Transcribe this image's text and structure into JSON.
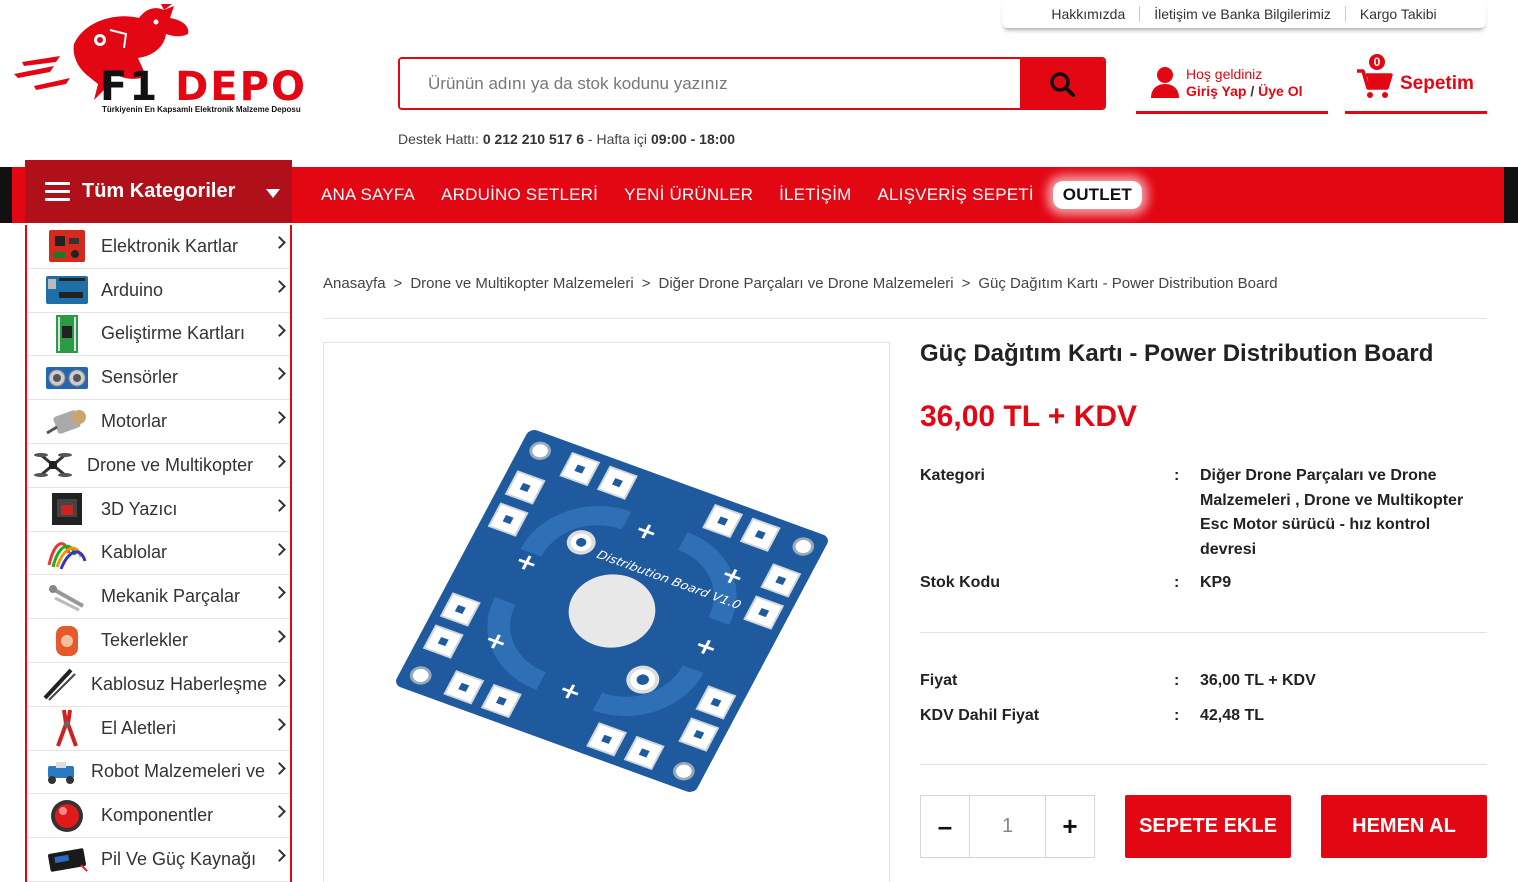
{
  "top_links": [
    "Hakkımızda",
    "İletişim ve Banka Bilgilerimiz",
    "Kargo Takibi"
  ],
  "logo": {
    "f1": "F1",
    "depo": "DEPO",
    "tagline": "Türkiyenin En Kapsamlı Elektronik Malzeme Deposu"
  },
  "search": {
    "placeholder": "Ürünün adını ya da stok kodunu yazınız"
  },
  "support": {
    "label": "Destek Hattı:",
    "phone": "0 212 210 517 6",
    "hours_label": "- Hafta içi",
    "hours": "09:00 - 18:00"
  },
  "account": {
    "greeting": "Hoş geldiniz",
    "login": "Giriş Yap",
    "slash": "/",
    "register": "Üye Ol"
  },
  "cart": {
    "count": "0",
    "label": "Sepetim"
  },
  "nav": {
    "all_categories": "Tüm Kategoriler",
    "items": [
      "ANA SAYFA",
      "ARDUİNO SETLERİ",
      "YENİ ÜRÜNLER",
      "İLETİŞİM",
      "ALIŞVERİŞ SEPETİ"
    ],
    "outlet": "OUTLET"
  },
  "categories": [
    {
      "name": "Elektronik Kartlar",
      "icon": "board-icon"
    },
    {
      "name": "Arduino",
      "icon": "arduino-icon"
    },
    {
      "name": "Geliştirme Kartları",
      "icon": "dev-board-icon"
    },
    {
      "name": "Sensörler",
      "icon": "sensor-icon"
    },
    {
      "name": "Motorlar",
      "icon": "motor-icon"
    },
    {
      "name": "Drone ve Multikopter",
      "icon": "drone-icon"
    },
    {
      "name": "3D Yazıcı",
      "icon": "printer-icon"
    },
    {
      "name": "Kablolar",
      "icon": "cable-icon"
    },
    {
      "name": "Mekanik Parçalar",
      "icon": "screw-icon"
    },
    {
      "name": "Tekerlekler",
      "icon": "wheel-icon"
    },
    {
      "name": "Kablosuz Haberleşme",
      "icon": "antenna-icon"
    },
    {
      "name": "El Aletleri",
      "icon": "pliers-icon"
    },
    {
      "name": "Robot Malzemeleri ve",
      "icon": "robot-icon"
    },
    {
      "name": "Komponentler",
      "icon": "button-icon"
    },
    {
      "name": "Pil Ve Güç Kaynağı",
      "icon": "battery-icon"
    }
  ],
  "breadcrumb": [
    "Anasayfa",
    "Drone ve Multikopter Malzemeleri",
    "Diğer Drone Parçaları ve Drone Malzemeleri",
    "Güç Dağıtım Kartı - Power Distribution Board"
  ],
  "breadcrumb_sep": ">",
  "product": {
    "title": "Güç Dağıtım Kartı - Power Distribution Board",
    "price": "36,00 TL + KDV",
    "image_label": "Distribution Board V1.0",
    "category_label": "Kategori",
    "category_value": "Diğer Drone Parçaları ve Drone Malzemeleri , Drone ve Multikopter Esc Motor sürücü - hız kontrol devresi",
    "sku_label": "Stok Kodu",
    "sku_value": "KP9",
    "price_label": "Fiyat",
    "price_value": "36,00 TL + KDV",
    "vat_price_label": "KDV Dahil Fiyat",
    "vat_price_value": "42,48 TL",
    "colon": ":"
  },
  "purchase": {
    "minus": "–",
    "qty": "1",
    "plus": "+",
    "add_to_cart": "SEPETE EKLE",
    "buy_now": "HEMEN AL"
  },
  "colors": {
    "brand_red": "#e30613",
    "dark_red": "#b0101a",
    "pcb_blue": "#1f5a9e"
  }
}
